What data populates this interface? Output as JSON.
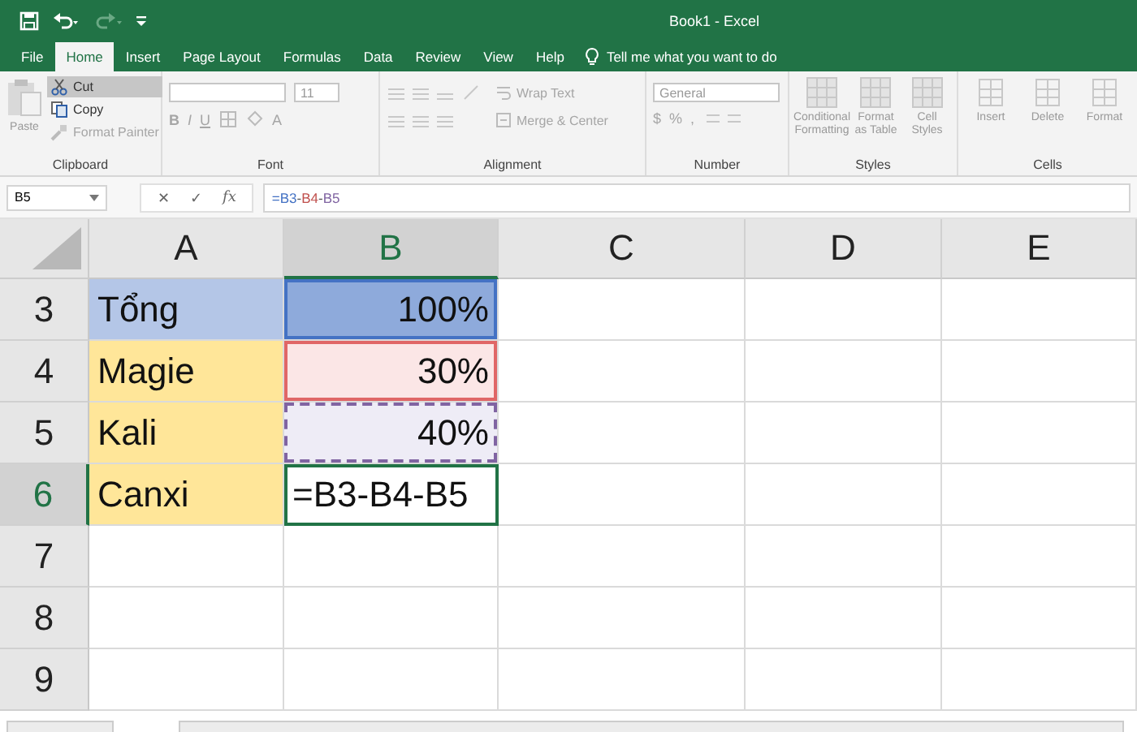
{
  "window": {
    "title": "Book1  -  Excel"
  },
  "tabs": [
    {
      "label": "File",
      "selected": false
    },
    {
      "label": "Home",
      "selected": true
    },
    {
      "label": "Insert",
      "selected": false
    },
    {
      "label": "Page Layout",
      "selected": false
    },
    {
      "label": "Formulas",
      "selected": false
    },
    {
      "label": "Data",
      "selected": false
    },
    {
      "label": "Review",
      "selected": false
    },
    {
      "label": "View",
      "selected": false
    },
    {
      "label": "Help",
      "selected": false
    }
  ],
  "tell_me": {
    "placeholder": "Tell me what you want to do"
  },
  "ribbon": {
    "clipboard": {
      "label": "Clipboard",
      "paste": {
        "text": "Paste",
        "disabled": true
      },
      "cut": {
        "text": "Cut",
        "highlighted": true
      },
      "copy": {
        "text": "Copy",
        "disabled": false
      },
      "format_painter": {
        "text": "Format Painter",
        "disabled": true
      }
    },
    "font": {
      "label": "Font",
      "size": "11",
      "style_buttons": [
        "B",
        "I",
        "U"
      ],
      "color_button": "A"
    },
    "alignment": {
      "label": "Alignment",
      "wrap_text": "Wrap Text",
      "merge_center": "Merge & Center"
    },
    "number": {
      "label": "Number",
      "format": "General",
      "symbols": [
        "$",
        "%",
        ","
      ]
    },
    "styles": {
      "label": "Styles",
      "buttons": [
        "Conditional Formatting",
        "Format as Table",
        "Cell Styles"
      ]
    },
    "cells": {
      "label": "Cells",
      "buttons": [
        "Insert",
        "Delete",
        "Format"
      ]
    }
  },
  "formula_bar": {
    "name_box": "B5",
    "cancel": "✕",
    "enter": "✓",
    "function": "fx",
    "formula": [
      {
        "text": "=",
        "color": "#4472c4"
      },
      {
        "text": "B3",
        "color": "#4472c4"
      },
      {
        "text": "-",
        "color": "#555555"
      },
      {
        "text": "B4",
        "color": "#c0504d"
      },
      {
        "text": "-",
        "color": "#555555"
      },
      {
        "text": "B5",
        "color": "#8064a2"
      }
    ]
  },
  "grid": {
    "columns": [
      {
        "label": "A",
        "selected": false
      },
      {
        "label": "B",
        "selected": true
      },
      {
        "label": "C",
        "selected": false
      },
      {
        "label": "D",
        "selected": false
      },
      {
        "label": "E",
        "selected": false
      }
    ],
    "rows": [
      {
        "header": "3",
        "selected": false,
        "cells": [
          {
            "text": "Tổng",
            "kind": "text",
            "color": "#b4c6e7"
          },
          {
            "text": "100%",
            "kind": "number",
            "color": "#8eaadb",
            "reference": {
              "color": "#4472c4",
              "dashed": false
            }
          }
        ]
      },
      {
        "header": "4",
        "selected": false,
        "cells": [
          {
            "text": "Magie",
            "kind": "text",
            "color": "#ffe699"
          },
          {
            "text": "30%",
            "kind": "number",
            "color": "#fbe6e6",
            "reference": {
              "color": "#e06666",
              "dashed": false
            }
          }
        ]
      },
      {
        "header": "5",
        "selected": false,
        "cells": [
          {
            "text": "Kali",
            "kind": "text",
            "color": "#ffe699"
          },
          {
            "text": "40%",
            "kind": "number",
            "color": "#eeecf6",
            "reference": {
              "color": "#8064a2",
              "dashed": true
            }
          }
        ]
      },
      {
        "header": "6",
        "selected": true,
        "cells": [
          {
            "text": "Canxi",
            "kind": "text",
            "color": "#ffe699"
          },
          {
            "text": "=B3-B4-B5",
            "kind": "text",
            "active": true
          }
        ]
      },
      {
        "header": "7",
        "selected": false
      },
      {
        "header": "8",
        "selected": false
      },
      {
        "header": "9",
        "selected": false
      }
    ]
  }
}
